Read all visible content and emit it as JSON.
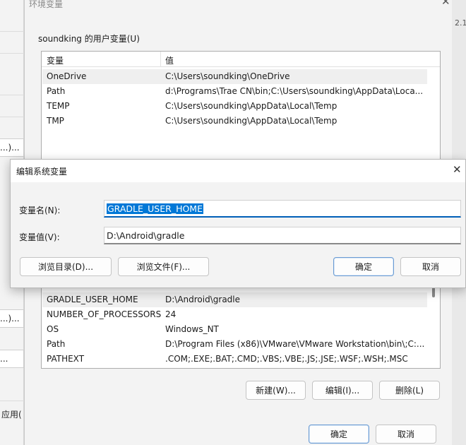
{
  "bg_window": {
    "button_1_label": "...)...",
    "button_2_label": "...)...",
    "button_3_label": "...",
    "apply_label": "应用("
  },
  "env_window": {
    "title": "环境变量",
    "edge_text": "2.1",
    "user_vars_label": "soundking 的用户变量(U)",
    "col_var": "变量",
    "col_val": "值",
    "user_vars": [
      {
        "name": "OneDrive",
        "value": "C:\\Users\\soundking\\OneDrive"
      },
      {
        "name": "Path",
        "value": "d:\\Programs\\Trae CN\\bin;C:\\Users\\soundking\\AppData\\Loca..."
      },
      {
        "name": "TEMP",
        "value": "C:\\Users\\soundking\\AppData\\Local\\Temp"
      },
      {
        "name": "TMP",
        "value": "C:\\Users\\soundking\\AppData\\Local\\Temp"
      }
    ],
    "system_vars": [
      {
        "name": "GRADLE_USER_HOME",
        "value": "D:\\Android\\gradle"
      },
      {
        "name": "NUMBER_OF_PROCESSORS",
        "value": "24"
      },
      {
        "name": "OS",
        "value": "Windows_NT"
      },
      {
        "name": "Path",
        "value": "D:\\Program Files (x86)\\VMware\\VMware Workstation\\bin\\;C:..."
      },
      {
        "name": "PATHEXT",
        "value": ".COM;.EXE;.BAT;.CMD;.VBS;.VBE;.JS;.JSE;.WSF;.WSH;.MSC"
      }
    ],
    "new_label": "新建(W)...",
    "edit_label": "编辑(I)...",
    "delete_label": "删除(L)",
    "ok_label": "确定",
    "cancel_label": "取消"
  },
  "edit_dialog": {
    "title": "编辑系统变量",
    "name_label": "变量名(N):",
    "value_label": "变量值(V):",
    "name_value": "GRADLE_USER_HOME",
    "value_value": "D:\\Android\\gradle",
    "browse_dir_label": "浏览目录(D)...",
    "browse_file_label": "浏览文件(F)...",
    "ok_label": "确定",
    "cancel_label": "取消"
  },
  "colors": {
    "accent": "#0078d7",
    "selection_bg": "#efefef",
    "window_bg": "#f3f3f3"
  }
}
